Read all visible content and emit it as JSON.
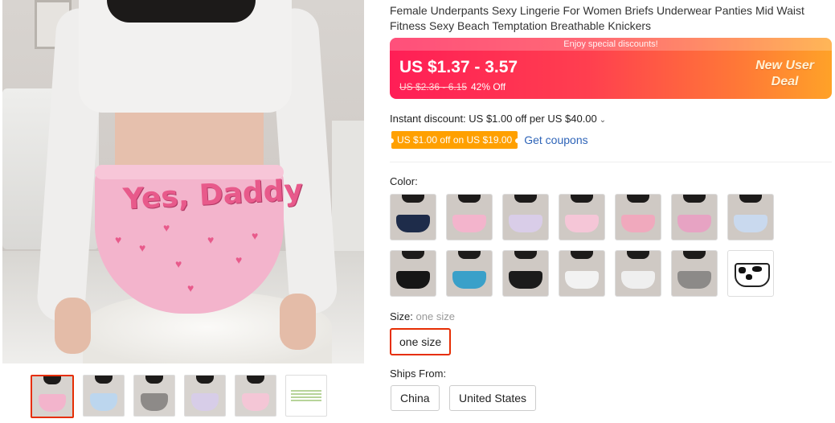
{
  "product": {
    "title": "Female Underpants Sexy Lingerie For Women Briefs Underwear Panties Mid Waist Fitness Sexy Beach Temptation Breathable Knickers",
    "main_image_print_text": "Yes, Daddy"
  },
  "price": {
    "promo_strip": "Enjoy special discounts!",
    "current": "US $1.37 - 3.57",
    "original": "US $2.36 - 6.15",
    "discount": "42% Off",
    "deal_line1": "New User",
    "deal_line2": "Deal"
  },
  "instant_discount": {
    "text": "Instant discount: US $1.00 off per US $40.00",
    "chevron": "⌄"
  },
  "coupon": {
    "tag": "US $1.00 off on US $19.00",
    "link": "Get coupons"
  },
  "color": {
    "label": "Color:",
    "swatch_count": 14,
    "selected_index": null
  },
  "size": {
    "label": "Size:",
    "selected_value": "one size",
    "options": [
      "one size"
    ]
  },
  "ships_from": {
    "label": "Ships From:",
    "options": [
      "China",
      "United States"
    ]
  },
  "gallery": {
    "thumbnail_count": 6,
    "active_index": 0
  },
  "colors": {
    "accent_red": "#e62e04",
    "coupon_orange": "#ffa000",
    "link_blue": "#2e64b8",
    "price_gradient_start": "#ff1e56",
    "price_gradient_end": "#ffa228"
  }
}
